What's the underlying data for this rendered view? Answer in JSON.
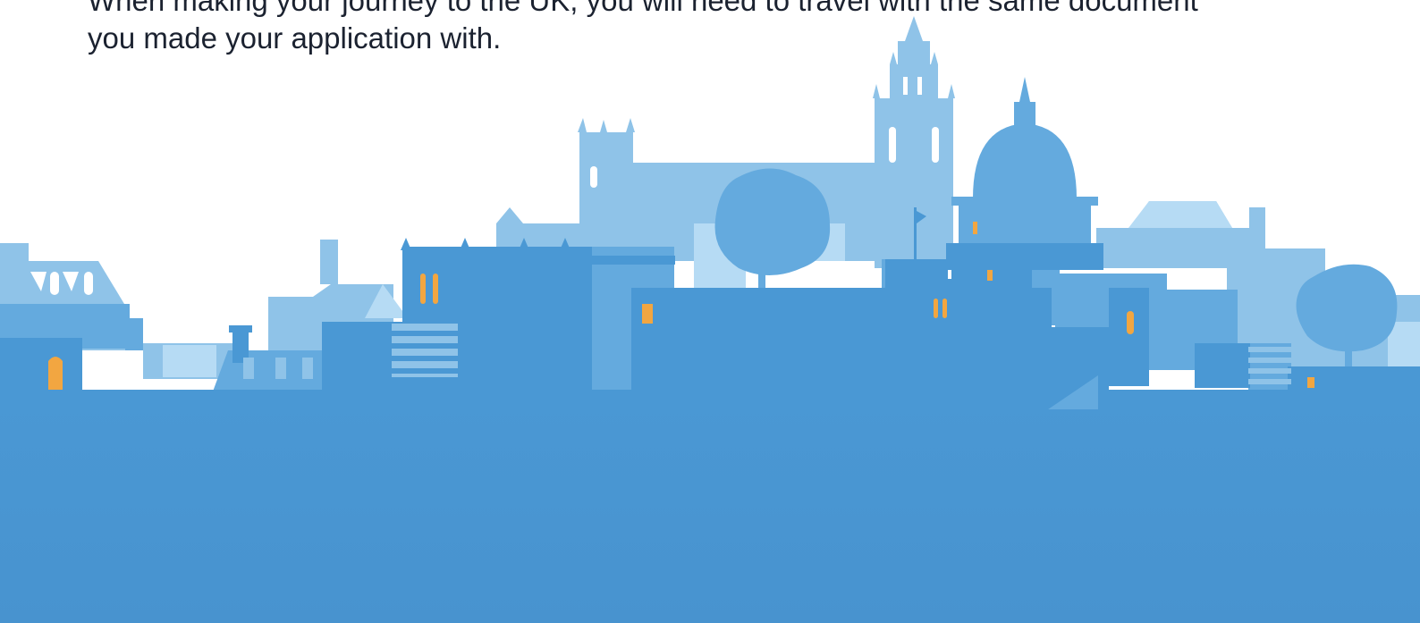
{
  "content": {
    "intro_lines": [
      "When making your journey to the UK, you will need to travel with the same document",
      "you made your application with."
    ]
  },
  "illustration": {
    "name": "city-skyline",
    "colors": {
      "foreground": "#4a98d4",
      "midground": "#64aade",
      "background": "#8fc3e8",
      "pale": "#b6dbf4",
      "window_light": "#f2a641",
      "ground_bottom": "#4893cf"
    }
  }
}
